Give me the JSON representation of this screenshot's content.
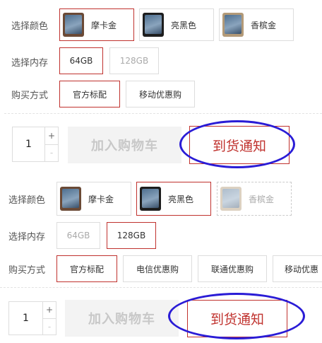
{
  "panel1": {
    "color_label": "选择颜色",
    "colors": [
      "摩卡金",
      "亮黑色",
      "香槟金"
    ],
    "memory_label": "选择内存",
    "memory": [
      "64GB",
      "128GB"
    ],
    "purchase_label": "购买方式",
    "purchase": [
      "官方标配",
      "移动优惠购"
    ],
    "quantity": "1",
    "plus": "+",
    "minus": "-",
    "cart_label": "加入购物车",
    "notify_label": "到货通知"
  },
  "panel2": {
    "color_label": "选择颜色",
    "colors": [
      "摩卡金",
      "亮黑色",
      "香槟金"
    ],
    "memory_label": "选择内存",
    "memory": [
      "64GB",
      "128GB"
    ],
    "purchase_label": "购买方式",
    "purchase": [
      "官方标配",
      "电信优惠购",
      "联通优惠购",
      "移动优惠"
    ],
    "quantity": "1",
    "plus": "+",
    "minus": "-",
    "cart_label": "加入购物车",
    "notify_label": "到货通知"
  },
  "colors": {
    "selected_border": "#c0322e",
    "annotation": "#2a1cd6",
    "cart_text": "#c8c8c8"
  }
}
